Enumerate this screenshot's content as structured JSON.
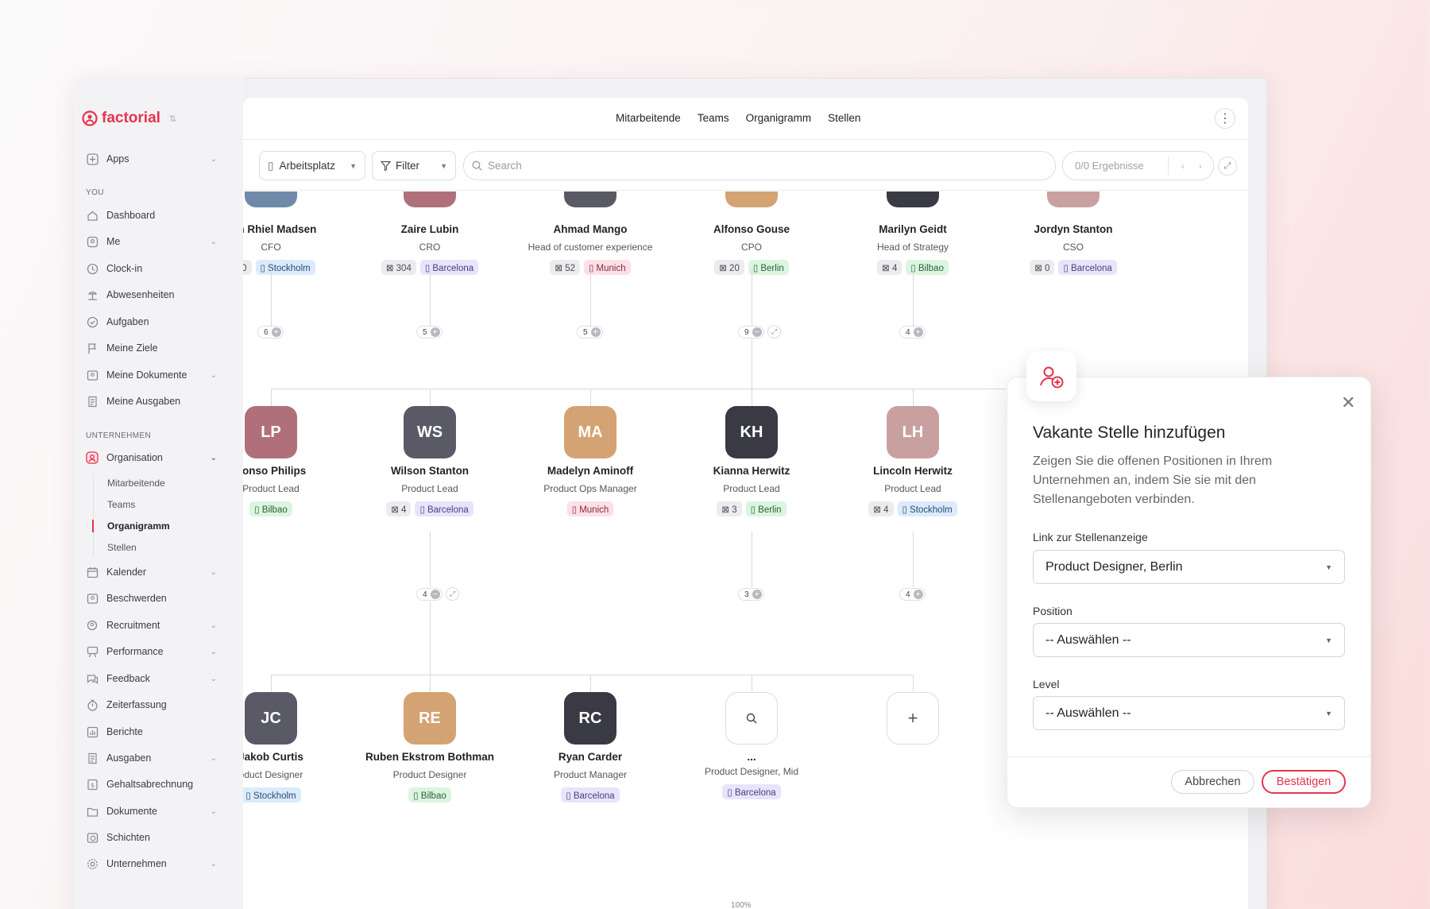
{
  "app": {
    "brand": "factorial",
    "accent": "#e5344d"
  },
  "sidebar": {
    "apps": "Apps",
    "sections": {
      "you": "YOU",
      "company": "UNTERNEHMEN"
    },
    "you_items": [
      "Dashboard",
      "Me",
      "Clock-in",
      "Abwesenheiten",
      "Aufgaben",
      "Meine Ziele",
      "Meine Dokumente",
      "Meine Ausgaben"
    ],
    "org": "Organisation",
    "org_sub": [
      "Mitarbeitende",
      "Teams",
      "Organigramm",
      "Stellen"
    ],
    "company_items": [
      "Kalender",
      "Beschwerden",
      "Recruitment",
      "Performance",
      "Feedback",
      "Zeiterfassung",
      "Berichte",
      "Ausgaben",
      "Gehaltsabrechnung",
      "Dokumente",
      "Schichten",
      "Unternehmen"
    ]
  },
  "topnav": {
    "tabs": [
      "Mitarbeitende",
      "Teams",
      "Organigramm",
      "Stellen"
    ]
  },
  "toolbar": {
    "workplace": "Arbeitsplatz",
    "filter": "Filter",
    "search_placeholder": "Search",
    "results": "0/0 Ergebnisse"
  },
  "row1": [
    {
      "name": "son Rhiel Madsen",
      "role": "CFO",
      "count": "0",
      "loc": "Stockholm",
      "children": "6"
    },
    {
      "name": "Zaire Lubin",
      "role": "CRO",
      "count": "304",
      "loc": "Barcelona",
      "children": "5"
    },
    {
      "name": "Ahmad Mango",
      "role": "Head of customer experience",
      "count": "52",
      "loc": "Munich",
      "children": "5"
    },
    {
      "name": "Alfonso Gouse",
      "role": "CPO",
      "count": "20",
      "loc": "Berlin",
      "children": "9"
    },
    {
      "name": "Marilyn Geidt",
      "role": "Head of Strategy",
      "count": "4",
      "loc": "Bilbao",
      "children": "4"
    },
    {
      "name": "Jordyn Stanton",
      "role": "CSO",
      "count": "0",
      "loc": "Barcelona",
      "children": ""
    }
  ],
  "row2": [
    {
      "name": "lfonso Philips",
      "role": "Product Lead",
      "count": "",
      "loc": "Bilbao",
      "children": ""
    },
    {
      "name": "Wilson Stanton",
      "role": "Product Lead",
      "count": "4",
      "loc": "Barcelona",
      "children": "4"
    },
    {
      "name": "Madelyn Aminoff",
      "role": "Product Ops Manager",
      "count": "",
      "loc": "Munich",
      "children": ""
    },
    {
      "name": "Kianna Herwitz",
      "role": "Product Lead",
      "count": "3",
      "loc": "Berlin",
      "children": "3"
    },
    {
      "name": "Lincoln Herwitz",
      "role": "Product Lead",
      "count": "4",
      "loc": "Stockholm",
      "children": "4"
    }
  ],
  "row3": [
    {
      "name": "Jakob Curtis",
      "role": "oduct Designer",
      "loc": "Stockholm"
    },
    {
      "name": "Ruben Ekstrom Bothman",
      "role": "Product Designer",
      "loc": "Bilbao"
    },
    {
      "name": "Ryan Carder",
      "role": "Product Manager",
      "loc": "Barcelona"
    },
    {
      "name": "...",
      "role": "Product Designer, Mid",
      "loc": "Barcelona"
    }
  ],
  "zoom": "100%",
  "modal": {
    "title": "Vakante Stelle hinzufügen",
    "description": "Zeigen Sie die offenen Positionen in Ihrem Unternehmen an, indem Sie sie mit den Stellenangeboten verbinden.",
    "job_link_label": "Link zur Stellenanzeige",
    "job_link_value": "Product Designer, Berlin",
    "position_label": "Position",
    "position_value": "-- Auswählen --",
    "level_label": "Level",
    "level_value": "-- Auswählen --",
    "cancel": "Abbrechen",
    "confirm": "Bestätigen"
  }
}
